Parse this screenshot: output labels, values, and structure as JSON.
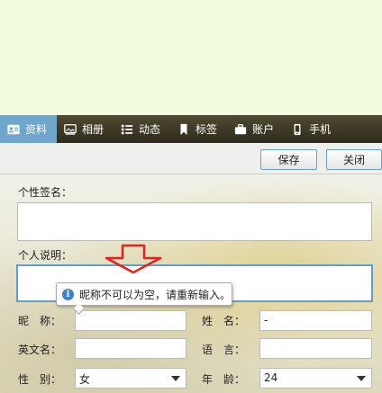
{
  "tabs": [
    {
      "label": "资料",
      "icon": "profile-card-icon",
      "active": true
    },
    {
      "label": "相册",
      "icon": "photo-album-icon",
      "active": false
    },
    {
      "label": "动态",
      "icon": "activity-list-icon",
      "active": false
    },
    {
      "label": "标签",
      "icon": "bookmark-tag-icon",
      "active": false
    },
    {
      "label": "账户",
      "icon": "briefcase-icon",
      "active": false
    },
    {
      "label": "手机",
      "icon": "mobile-phone-icon",
      "active": false
    }
  ],
  "toolbar": {
    "save_label": "保存",
    "close_label": "关闭"
  },
  "form": {
    "signature_label": "个性签名：",
    "signature_value": "",
    "description_label": "个人说明：",
    "description_value": "",
    "nickname_label": "昵　称：",
    "nickname_value": "",
    "surname_label": "姓　名：",
    "surname_value": "-",
    "english_name_label": "英文名：",
    "english_name_value": "",
    "language_label": "语　言：",
    "language_value": "",
    "gender_label": "性　别：",
    "gender_value": "女",
    "age_label": "年　龄：",
    "age_value": "24"
  },
  "tooltip": {
    "message": "昵称不可以为空，请重新输入。",
    "icon": "info-icon"
  },
  "annotation": {
    "shape": "red-down-arrow",
    "color": "#e0231c"
  },
  "colors": {
    "active_tab": "#6fa6cc",
    "focus_border": "#5f9fd2",
    "tabbar": "#3b3624"
  }
}
